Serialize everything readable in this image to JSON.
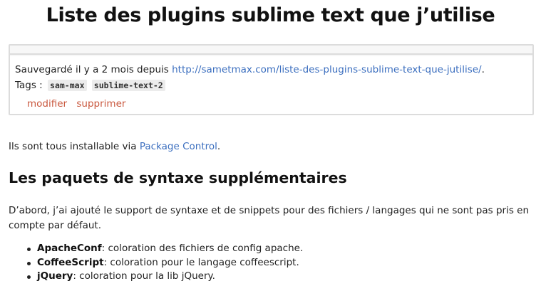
{
  "page": {
    "title": "Liste des plugins sublime text que j’utilise"
  },
  "meta": {
    "saved_prefix": "Sauvegardé il y a 2 mois depuis ",
    "source_url": "http://sametmax.com/liste-des-plugins-sublime-text-que-jutilise/",
    "saved_suffix": ".",
    "tags_label": "Tags :",
    "tags": [
      "sam-max",
      "sublime-text-2"
    ],
    "edit_label": "modifier",
    "delete_label": "supprimer"
  },
  "content": {
    "intro_prefix": "Ils sont tous installable via ",
    "intro_link": "Package Control",
    "intro_suffix": ".",
    "section_heading": "Les paquets de syntaxe supplémentaires",
    "paragraph": "D’abord, j’ai ajouté le support de syntaxe et de snippets pour des fichiers / langages qui ne sont pas pris en compte par défaut.",
    "plugins": [
      {
        "name": "ApacheConf",
        "desc": ": coloration des fichiers de config apache."
      },
      {
        "name": "CoffeeScript",
        "desc": ": coloration pour le langage coffeescript."
      },
      {
        "name": "jQuery",
        "desc": ": coloration pour la lib jQuery."
      }
    ]
  },
  "colors": {
    "link": "#3c6fbf",
    "action": "#c9573d",
    "border": "#dcdcdc"
  }
}
